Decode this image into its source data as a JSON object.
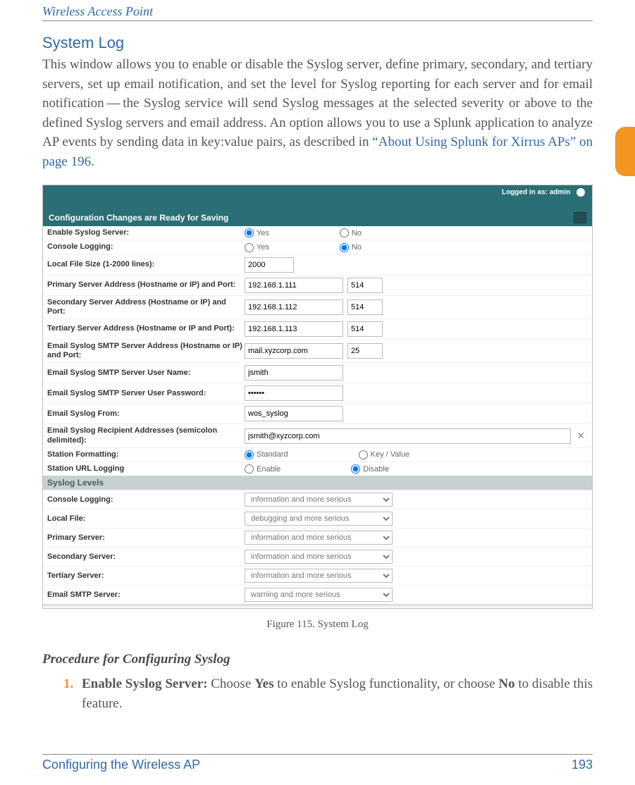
{
  "header": {
    "running": "Wireless Access Point"
  },
  "section": {
    "title": "System Log"
  },
  "para": {
    "p1a": "This window allows you to enable or disable the Syslog server, define primary, secondary, and tertiary servers, set up email notification, and set the level for Syslog reporting for each server and for email notification — the Syslog service will send Syslog messages at the selected severity or above to the defined Syslog servers and email address. An option allows you to use a Splunk application to analyze AP events by sending data in key:value pairs, as described in ",
    "p1link": "“About Using Splunk for Xirrus APs” on page 196",
    "p1b": "."
  },
  "shot": {
    "login": "Logged in as: admin",
    "bar": "Configuration Changes are Ready for Saving",
    "rows": {
      "enable_label": "Enable Syslog Server:",
      "enable_yes": "Yes",
      "enable_no": "No",
      "console_label": "Console Logging:",
      "console_yes": "Yes",
      "console_no": "No",
      "filesize_label": "Local File Size (1-2000 lines):",
      "filesize_val": "2000",
      "primary_label": "Primary Server Address (Hostname or IP) and Port:",
      "primary_host": "192.168.1.111",
      "primary_port": "514",
      "secondary_label": "Secondary Server Address (Hostname or IP) and Port:",
      "secondary_host": "192.168.1.112",
      "secondary_port": "514",
      "tertiary_label": "Tertiary Server Address (Hostname or IP and Port):",
      "tertiary_host": "192.168.1.113",
      "tertiary_port": "514",
      "smtp_label": "Email Syslog SMTP Server Address (Hostname or IP) and Port:",
      "smtp_host": "mail.xyzcorp.com",
      "smtp_port": "25",
      "user_label": "Email Syslog SMTP Server User Name:",
      "user_val": "jsmith",
      "pass_label": "Email Syslog SMTP Server User Password:",
      "pass_val": "••••••",
      "from_label": "Email Syslog From:",
      "from_val": "wos_syslog",
      "recip_label": "Email Syslog Recipient Addresses (semicolon delimited):",
      "recip_val": "jsmith@xyzcorp.com",
      "fmt_label": "Station Formatting:",
      "fmt_std": "Standard",
      "fmt_kv": "Key / Value",
      "url_label": "Station URL Logging",
      "url_en": "Enable",
      "url_dis": "Disable"
    },
    "levels_hdr": "Syslog Levels",
    "levels": {
      "console_label": "Console Logging:",
      "console_val": "information and more serious",
      "local_label": "Local File:",
      "local_val": "debugging and more serious",
      "primary_label": "Primary Server:",
      "primary_val": "information and more serious",
      "secondary_label": "Secondary Server:",
      "secondary_val": "information and more serious",
      "tertiary_label": "Tertiary Server:",
      "tertiary_val": "information and more serious",
      "email_label": "Email SMTP Server:",
      "email_val": "warning and more serious"
    }
  },
  "caption": "Figure 115. System Log",
  "proc": {
    "heading": "Procedure for Configuring Syslog",
    "n1": "1.",
    "s1a": "Enable Syslog Server:",
    "s1b": " Choose ",
    "s1c": "Yes",
    "s1d": " to enable Syslog functionality, or choose ",
    "s1e": "No",
    "s1f": " to disable this feature."
  },
  "footer": {
    "left": "Configuring the Wireless AP",
    "right": "193"
  }
}
